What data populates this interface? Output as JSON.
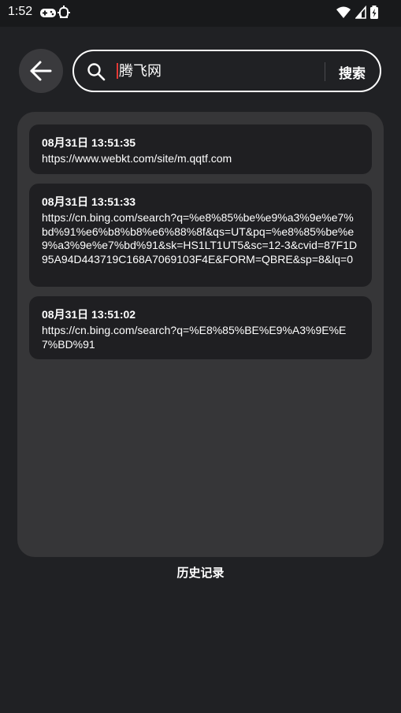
{
  "status_bar": {
    "time": "1:52",
    "icons": [
      "gamepad-icon",
      "bug-icon",
      "wifi-icon",
      "signal-icon",
      "battery-icon"
    ]
  },
  "search": {
    "query": "腾飞网",
    "button_label": "搜索",
    "icon": "search-icon"
  },
  "history": {
    "items": [
      {
        "time": "08月31日 13:51:35",
        "url": "https://www.webkt.com/site/m.qqtf.com"
      },
      {
        "time": "08月31日 13:51:33",
        "url": "https://cn.bing.com/search?q=%e8%85%be%e9%a3%9e%e7%bd%91%e6%b8%b8%e6%88%8f&qs=UT&pq=%e8%85%be%e9%a3%9e%e7%bd%91&sk=HS1LT1UT5&sc=12-3&cvid=87F1D95A94D443719C168A7069103F4E&FORM=QBRE&sp=8&lq=0"
      },
      {
        "time": "08月31日 13:51:02",
        "url": "https://cn.bing.com/search?q=%E8%85%BE%E9%A3%9E%E7%BD%91"
      }
    ],
    "label": "历史记录"
  },
  "colors": {
    "background": "#202124",
    "panel": "#363638",
    "card": "#1f1f22",
    "caret": "#e53935"
  }
}
